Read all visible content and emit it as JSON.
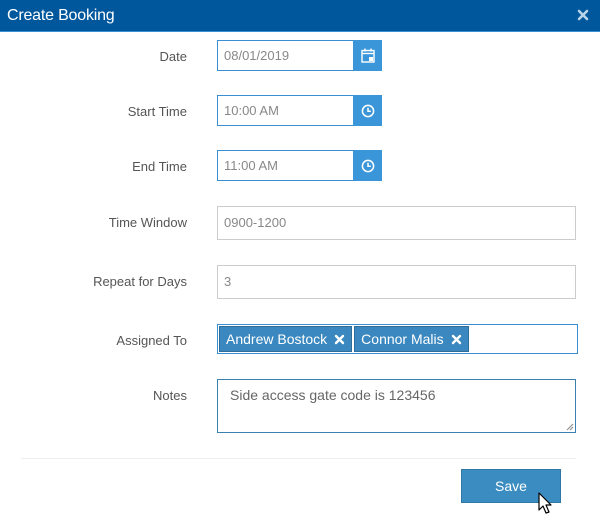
{
  "dialog": {
    "title": "Create Booking",
    "close_icon": "close-icon"
  },
  "fields": {
    "date": {
      "label": "Date",
      "value": "08/01/2019",
      "icon": "calendar-icon"
    },
    "start_time": {
      "label": "Start Time",
      "value": "10:00 AM",
      "icon": "clock-icon"
    },
    "end_time": {
      "label": "End Time",
      "value": "11:00 AM",
      "icon": "clock-icon"
    },
    "time_window": {
      "label": "Time Window",
      "value": "0900-1200"
    },
    "repeat_for_days": {
      "label": "Repeat for Days",
      "value": "3"
    },
    "assigned_to": {
      "label": "Assigned To",
      "tags": [
        {
          "name": "Andrew Bostock"
        },
        {
          "name": "Connor Malis"
        }
      ]
    },
    "notes": {
      "label": "Notes",
      "value": "Side access gate code is 123456"
    }
  },
  "footer": {
    "save_label": "Save"
  },
  "colors": {
    "titlebar": "#00579c",
    "accent": "#3a96d8",
    "tag": "#3a88bf",
    "button": "#3b8cc0"
  }
}
